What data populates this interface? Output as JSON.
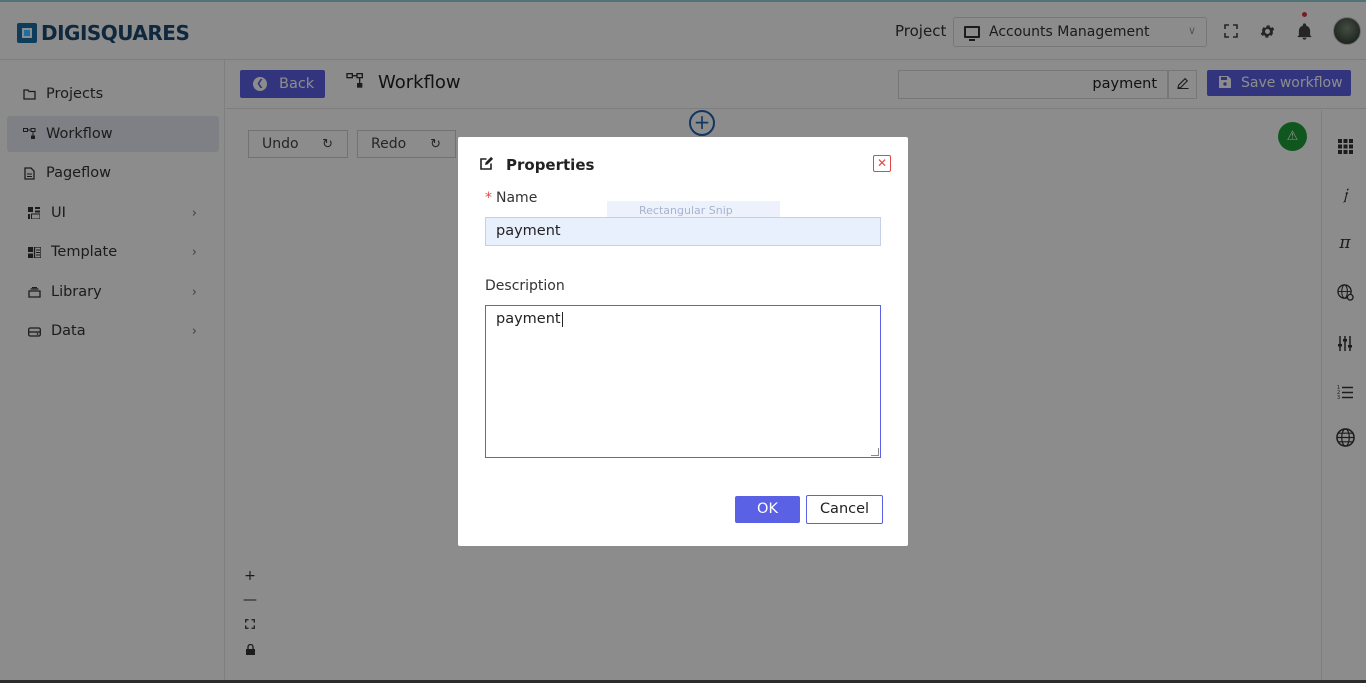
{
  "header": {
    "logo_text": "DIGISQUARES",
    "project_label": "Project",
    "project_selected": "Accounts Management"
  },
  "sidebar": {
    "items": [
      {
        "label": "Projects",
        "icon": "folder-icon"
      },
      {
        "label": "Workflow",
        "icon": "workflow-icon",
        "active": true
      },
      {
        "label": "Pageflow",
        "icon": "document-icon"
      },
      {
        "label": "UI",
        "icon": "ui-grid-icon",
        "expandable": true
      },
      {
        "label": "Template",
        "icon": "template-icon",
        "expandable": true
      },
      {
        "label": "Library",
        "icon": "library-icon",
        "expandable": true
      },
      {
        "label": "Data",
        "icon": "database-icon",
        "expandable": true
      }
    ]
  },
  "toolbar": {
    "back_label": "Back",
    "title": "Workflow",
    "workflow_name": "payment",
    "save_label": "Save workflow"
  },
  "canvas": {
    "undo_label": "Undo",
    "redo_label": "Redo"
  },
  "modal": {
    "title": "Properties",
    "name_label": "Name",
    "name_value": "payment",
    "description_label": "Description",
    "description_value": "payment",
    "ok_label": "OK",
    "cancel_label": "Cancel",
    "snip_hint": "Rectangular Snip"
  },
  "colors": {
    "accent": "#5b61e5",
    "brand": "#1a6fa8",
    "warning_badge": "#1e9e3a",
    "close": "#e04848"
  }
}
